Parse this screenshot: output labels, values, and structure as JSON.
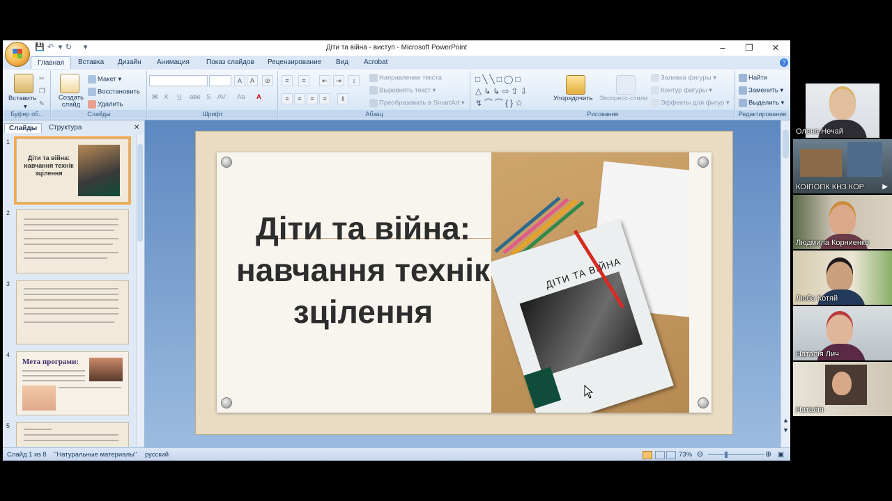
{
  "window": {
    "title": "Діти та війна - виступ - Microsoft PowerPoint"
  },
  "tabs": [
    "Главная",
    "Вставка",
    "Дизайн",
    "Анимация",
    "Показ слайдов",
    "Рецензирование",
    "Вид",
    "Acrobat"
  ],
  "ribbon": {
    "clipboard": {
      "paste": "Вставить",
      "label": "Буфер об..."
    },
    "slides": {
      "new_slide": "Создать слайд",
      "layout": "Макет",
      "reset": "Восстановить",
      "delete": "Удалить",
      "label": "Слайды"
    },
    "font": {
      "label": "Шрифт"
    },
    "paragraph": {
      "text_direction": "Направление текста",
      "align_text": "Выровнять текст",
      "smartart": "Преобразовать в SmartArt",
      "label": "Абзац"
    },
    "drawing": {
      "arrange": "Упорядочить",
      "quick_styles": "Экспресс-стили",
      "fill": "Заливка фигуры",
      "outline": "Контур фигуры",
      "effects": "Эффекты для фигур",
      "label": "Рисование"
    },
    "editing": {
      "find": "Найти",
      "replace": "Заменить",
      "select": "Выделить",
      "label": "Редактирование"
    }
  },
  "panel": {
    "tabs": [
      "Слайды",
      "Структура"
    ],
    "thumbs": [
      {
        "num": "1",
        "title": "Діти та війна: навчання технік зцілення"
      },
      {
        "num": "2"
      },
      {
        "num": "3"
      },
      {
        "num": "4",
        "title": "Мета програми:"
      },
      {
        "num": "5"
      }
    ]
  },
  "slide": {
    "title_line1": "Діти та війна:",
    "title_line2": "навчання технік",
    "title_line3": "зцілення",
    "book_title": "ДІТИ ТА ВІЙНА"
  },
  "status": {
    "slide_info": "Слайд 1 из 8",
    "theme": "\"Натуральные материалы\"",
    "language": "русский",
    "zoom": "73%"
  },
  "participants": [
    "Олена Нечай",
    "КОІПОПК КНЗ КОР",
    "Людмила Корниенко",
    "Люба Котяй",
    "Наталія Лич",
    "Наталія"
  ]
}
